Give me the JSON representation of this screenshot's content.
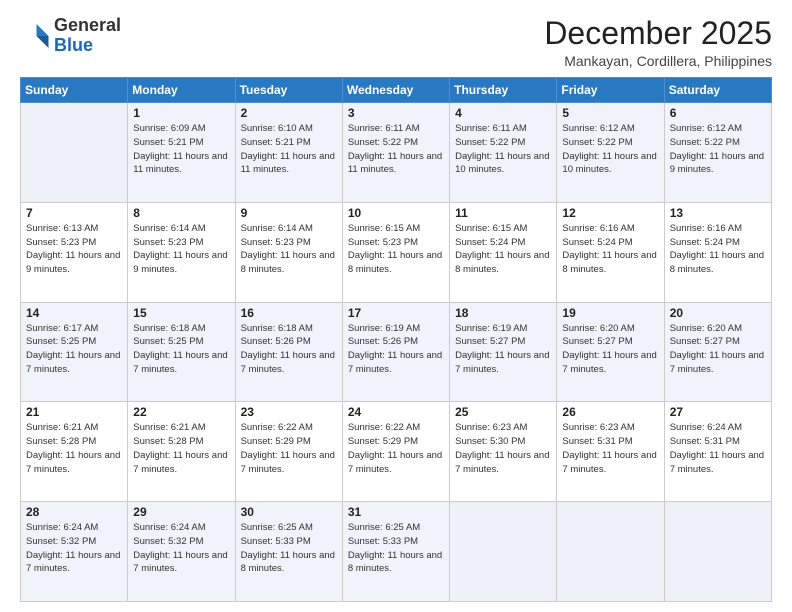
{
  "header": {
    "logo": {
      "general": "General",
      "blue": "Blue"
    },
    "title": "December 2025",
    "subtitle": "Mankayan, Cordillera, Philippines"
  },
  "weekdays": [
    "Sunday",
    "Monday",
    "Tuesday",
    "Wednesday",
    "Thursday",
    "Friday",
    "Saturday"
  ],
  "weeks": [
    [
      {
        "day": "",
        "empty": true
      },
      {
        "day": "1",
        "sunrise": "6:09 AM",
        "sunset": "5:21 PM",
        "daylight": "11 hours and 11 minutes."
      },
      {
        "day": "2",
        "sunrise": "6:10 AM",
        "sunset": "5:21 PM",
        "daylight": "11 hours and 11 minutes."
      },
      {
        "day": "3",
        "sunrise": "6:11 AM",
        "sunset": "5:22 PM",
        "daylight": "11 hours and 11 minutes."
      },
      {
        "day": "4",
        "sunrise": "6:11 AM",
        "sunset": "5:22 PM",
        "daylight": "11 hours and 10 minutes."
      },
      {
        "day": "5",
        "sunrise": "6:12 AM",
        "sunset": "5:22 PM",
        "daylight": "11 hours and 10 minutes."
      },
      {
        "day": "6",
        "sunrise": "6:12 AM",
        "sunset": "5:22 PM",
        "daylight": "11 hours and 9 minutes."
      }
    ],
    [
      {
        "day": "7",
        "sunrise": "6:13 AM",
        "sunset": "5:23 PM",
        "daylight": "11 hours and 9 minutes."
      },
      {
        "day": "8",
        "sunrise": "6:14 AM",
        "sunset": "5:23 PM",
        "daylight": "11 hours and 9 minutes."
      },
      {
        "day": "9",
        "sunrise": "6:14 AM",
        "sunset": "5:23 PM",
        "daylight": "11 hours and 8 minutes."
      },
      {
        "day": "10",
        "sunrise": "6:15 AM",
        "sunset": "5:23 PM",
        "daylight": "11 hours and 8 minutes."
      },
      {
        "day": "11",
        "sunrise": "6:15 AM",
        "sunset": "5:24 PM",
        "daylight": "11 hours and 8 minutes."
      },
      {
        "day": "12",
        "sunrise": "6:16 AM",
        "sunset": "5:24 PM",
        "daylight": "11 hours and 8 minutes."
      },
      {
        "day": "13",
        "sunrise": "6:16 AM",
        "sunset": "5:24 PM",
        "daylight": "11 hours and 8 minutes."
      }
    ],
    [
      {
        "day": "14",
        "sunrise": "6:17 AM",
        "sunset": "5:25 PM",
        "daylight": "11 hours and 7 minutes."
      },
      {
        "day": "15",
        "sunrise": "6:18 AM",
        "sunset": "5:25 PM",
        "daylight": "11 hours and 7 minutes."
      },
      {
        "day": "16",
        "sunrise": "6:18 AM",
        "sunset": "5:26 PM",
        "daylight": "11 hours and 7 minutes."
      },
      {
        "day": "17",
        "sunrise": "6:19 AM",
        "sunset": "5:26 PM",
        "daylight": "11 hours and 7 minutes."
      },
      {
        "day": "18",
        "sunrise": "6:19 AM",
        "sunset": "5:27 PM",
        "daylight": "11 hours and 7 minutes."
      },
      {
        "day": "19",
        "sunrise": "6:20 AM",
        "sunset": "5:27 PM",
        "daylight": "11 hours and 7 minutes."
      },
      {
        "day": "20",
        "sunrise": "6:20 AM",
        "sunset": "5:27 PM",
        "daylight": "11 hours and 7 minutes."
      }
    ],
    [
      {
        "day": "21",
        "sunrise": "6:21 AM",
        "sunset": "5:28 PM",
        "daylight": "11 hours and 7 minutes."
      },
      {
        "day": "22",
        "sunrise": "6:21 AM",
        "sunset": "5:28 PM",
        "daylight": "11 hours and 7 minutes."
      },
      {
        "day": "23",
        "sunrise": "6:22 AM",
        "sunset": "5:29 PM",
        "daylight": "11 hours and 7 minutes."
      },
      {
        "day": "24",
        "sunrise": "6:22 AM",
        "sunset": "5:29 PM",
        "daylight": "11 hours and 7 minutes."
      },
      {
        "day": "25",
        "sunrise": "6:23 AM",
        "sunset": "5:30 PM",
        "daylight": "11 hours and 7 minutes."
      },
      {
        "day": "26",
        "sunrise": "6:23 AM",
        "sunset": "5:31 PM",
        "daylight": "11 hours and 7 minutes."
      },
      {
        "day": "27",
        "sunrise": "6:24 AM",
        "sunset": "5:31 PM",
        "daylight": "11 hours and 7 minutes."
      }
    ],
    [
      {
        "day": "28",
        "sunrise": "6:24 AM",
        "sunset": "5:32 PM",
        "daylight": "11 hours and 7 minutes."
      },
      {
        "day": "29",
        "sunrise": "6:24 AM",
        "sunset": "5:32 PM",
        "daylight": "11 hours and 7 minutes."
      },
      {
        "day": "30",
        "sunrise": "6:25 AM",
        "sunset": "5:33 PM",
        "daylight": "11 hours and 8 minutes."
      },
      {
        "day": "31",
        "sunrise": "6:25 AM",
        "sunset": "5:33 PM",
        "daylight": "11 hours and 8 minutes."
      },
      {
        "day": "",
        "empty": true
      },
      {
        "day": "",
        "empty": true
      },
      {
        "day": "",
        "empty": true
      }
    ]
  ],
  "labels": {
    "sunrise": "Sunrise:",
    "sunset": "Sunset:",
    "daylight": "Daylight:"
  }
}
